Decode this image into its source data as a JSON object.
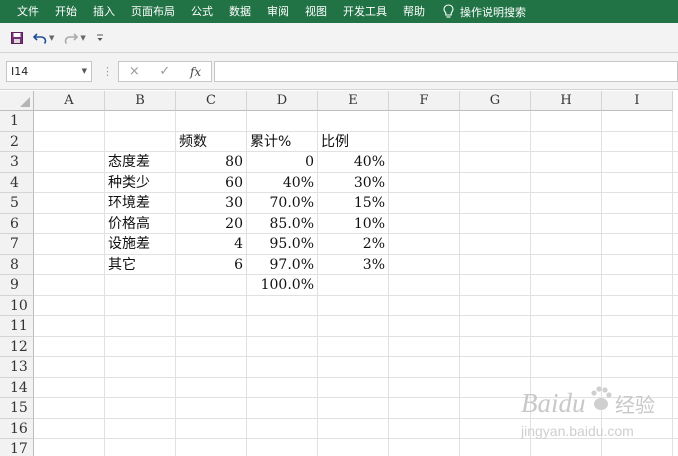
{
  "ribbon": {
    "tabs": [
      "文件",
      "开始",
      "插入",
      "页面布局",
      "公式",
      "数据",
      "审阅",
      "视图",
      "开发工具",
      "帮助"
    ],
    "tell_me": "操作说明搜索",
    "color": "#217346"
  },
  "quick_access": {
    "save": "save-icon",
    "undo": "undo-icon",
    "redo": "redo-icon",
    "customize": "customize-icon"
  },
  "formula_bar": {
    "name_box": "I14",
    "cancel": "×",
    "enter": "✓",
    "fx": "fx",
    "formula": ""
  },
  "columns": [
    "A",
    "B",
    "C",
    "D",
    "E",
    "F",
    "G",
    "H",
    "I"
  ],
  "rows": [
    "1",
    "2",
    "3",
    "4",
    "5",
    "6",
    "7",
    "8",
    "9",
    "10",
    "11",
    "12",
    "13",
    "14",
    "15",
    "16",
    "17"
  ],
  "cells": {
    "C2": "频数",
    "D2": "累计%",
    "E2": "比例",
    "B3": "态度差",
    "C3": "80",
    "D3": "0",
    "E3": "40%",
    "B4": "种类少",
    "C4": "60",
    "D4": "40%",
    "E4": "30%",
    "B5": "环境差",
    "C5": "30",
    "D5": "70.0%",
    "E5": "15%",
    "B6": "价格高",
    "C6": "20",
    "D6": "85.0%",
    "E6": "10%",
    "B7": "设施差",
    "C7": "4",
    "D7": "95.0%",
    "E7": "2%",
    "B8": "其它",
    "C8": "6",
    "D8": "97.0%",
    "E8": "3%",
    "D9": "100.0%"
  },
  "watermark": {
    "brand": "Baidu",
    "brand_cn": "经验",
    "url": "jingyan.baidu.com"
  }
}
